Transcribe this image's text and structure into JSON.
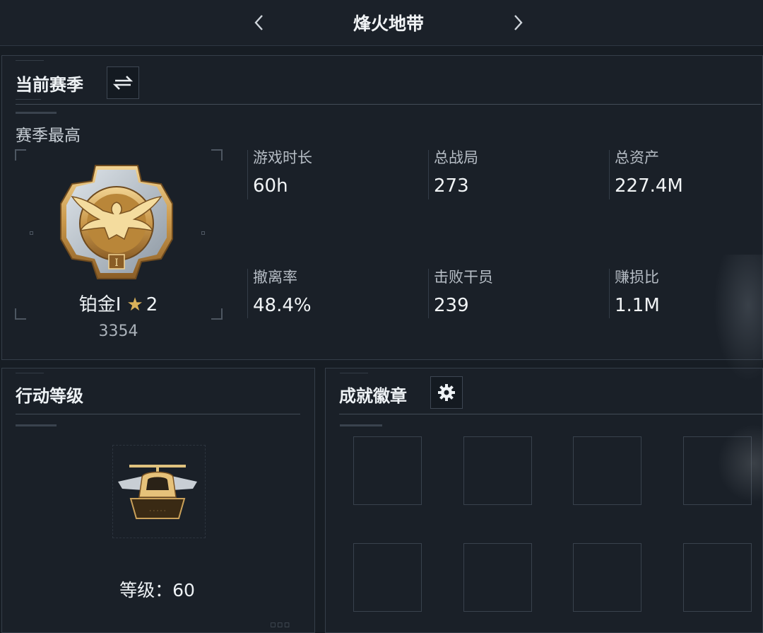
{
  "header": {
    "title": "烽火地带",
    "prev_icon": "chevron-left-icon",
    "next_icon": "chevron-right-icon"
  },
  "season": {
    "title": "当前赛季",
    "switch_icon": "swap-arrows-icon",
    "best_label": "赛季最高",
    "rank_name": "铂金Ⅰ",
    "rank_stars": "2",
    "rank_score": "3354",
    "stats": [
      {
        "label": "游戏时长",
        "value": "60h"
      },
      {
        "label": "总战局",
        "value": "273"
      },
      {
        "label": "总资产",
        "value": "227.4M"
      },
      {
        "label": "撤离率",
        "value": "48.4%"
      },
      {
        "label": "击败干员",
        "value": "239"
      },
      {
        "label": "赚损比",
        "value": "1.1M"
      }
    ]
  },
  "operation": {
    "title": "行动等级",
    "level_label": "等级：",
    "level_value": "60"
  },
  "achievements": {
    "title": "成就徽章",
    "settings_icon": "gear-icon",
    "slots": 8
  },
  "colors": {
    "background": "#171d24",
    "panel": "#1a2028",
    "border": "#353e49",
    "gold": "#d9b15a"
  }
}
